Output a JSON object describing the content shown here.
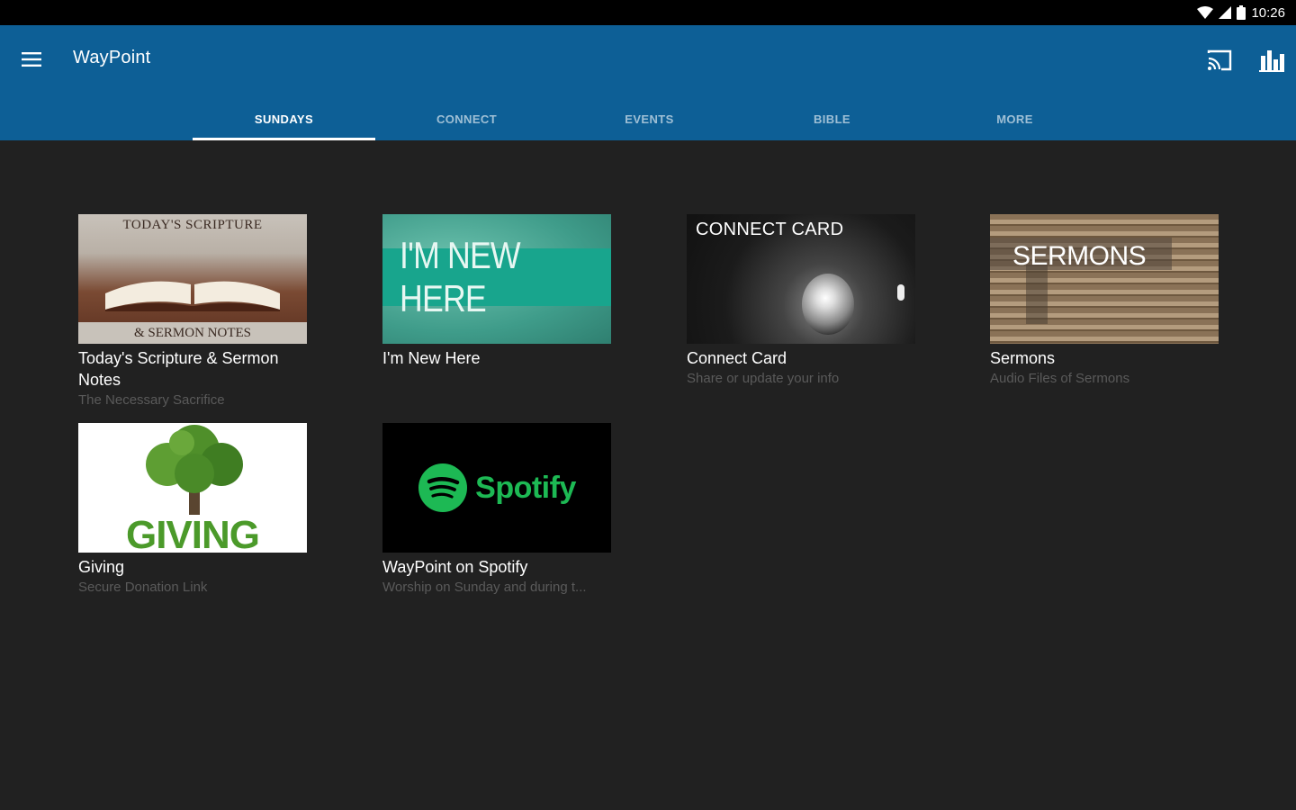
{
  "status": {
    "time": "10:26"
  },
  "appbar": {
    "title": "WayPoint"
  },
  "tabs": [
    {
      "label": "SUNDAYS",
      "active": true
    },
    {
      "label": "CONNECT",
      "active": false
    },
    {
      "label": "EVENTS",
      "active": false
    },
    {
      "label": "BIBLE",
      "active": false
    },
    {
      "label": "MORE",
      "active": false
    }
  ],
  "cards": [
    {
      "title": "Today's Scripture & Sermon Notes",
      "subtitle": "The Necessary Sacrifice",
      "thumb_top": "TODAY'S SCRIPTURE",
      "thumb_bottom": "& SERMON NOTES"
    },
    {
      "title": "I'm New Here",
      "subtitle": "",
      "thumb_text": "I'M NEW HERE"
    },
    {
      "title": "Connect Card",
      "subtitle": "Share or update your info",
      "thumb_text": "CONNECT CARD"
    },
    {
      "title": "Sermons",
      "subtitle": "Audio Files of Sermons",
      "thumb_text": "SERMONS"
    },
    {
      "title": "Giving",
      "subtitle": "Secure Donation Link",
      "thumb_text": "GIVING"
    },
    {
      "title": "WayPoint on Spotify",
      "subtitle": "Worship on Sunday and during t...",
      "thumb_text": "Spotify"
    }
  ],
  "colors": {
    "appbar": "#0d5f96",
    "background": "#212121",
    "spotify_green": "#1db954",
    "giving_green": "#4b9a2a"
  },
  "icons": [
    "wifi-icon",
    "signal-icon",
    "battery-icon",
    "menu-icon",
    "cast-icon",
    "bar-chart-icon"
  ]
}
